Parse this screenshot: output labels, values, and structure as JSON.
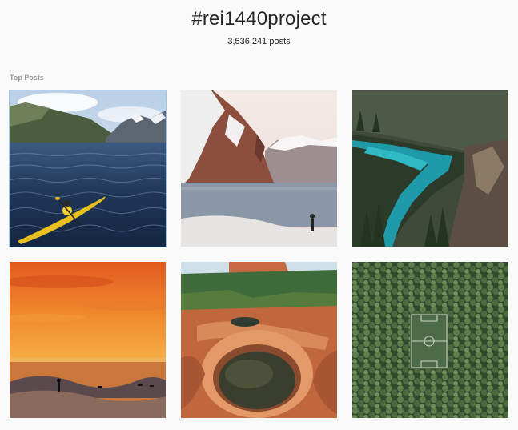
{
  "header": {
    "hashtag": "#rei1440project",
    "post_count": "3,536,241 posts"
  },
  "top_posts": {
    "label": "Top Posts",
    "items": [
      {
        "subject": "kayaker-in-fjord"
      },
      {
        "subject": "snowy-coastal-cliffs"
      },
      {
        "subject": "turquoise-river-forest"
      },
      {
        "subject": "sunset-surfers"
      },
      {
        "subject": "red-rock-pool"
      },
      {
        "subject": "forest-soccer-field"
      }
    ]
  }
}
